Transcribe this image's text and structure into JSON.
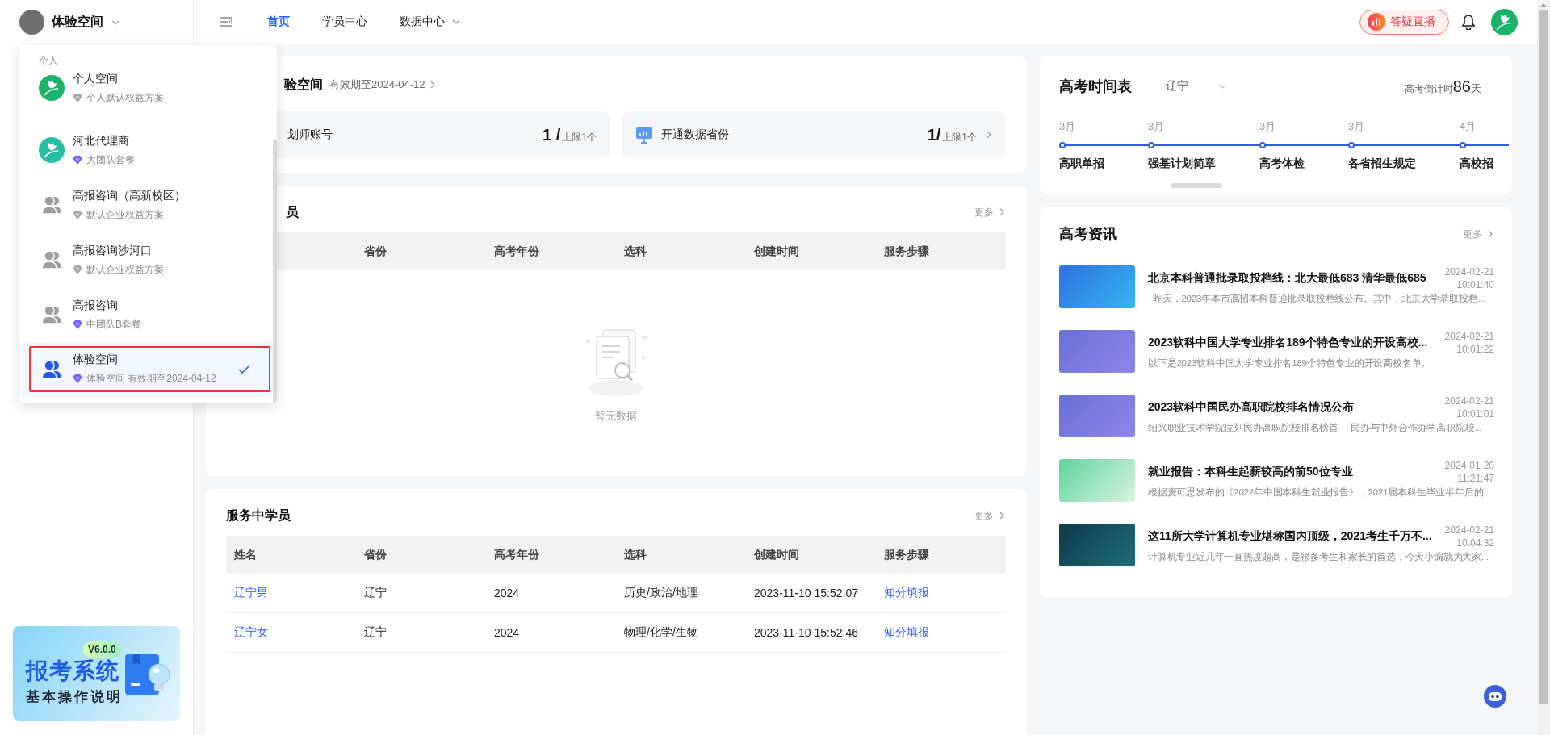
{
  "sidebar": {
    "account_name": "体验空间",
    "banner": {
      "version": "V6.0.0",
      "title": "报考系统",
      "subtitle": "基本操作说明"
    }
  },
  "topbar": {
    "nav": [
      {
        "label": "首页",
        "selected": true,
        "has_menu": false
      },
      {
        "label": "学员中心",
        "selected": false,
        "has_menu": false
      },
      {
        "label": "数据中心",
        "selected": false,
        "has_menu": true
      }
    ],
    "live_button": "答疑直播"
  },
  "space_summary": {
    "title": "验空间",
    "validity": "有效期至2024-04-12",
    "stats": [
      {
        "label": "划师账号",
        "count": "1 /",
        "limit": "上限1个",
        "has_icon": false,
        "has_arrow": false
      },
      {
        "label": "开通数据省份",
        "count": "1/",
        "limit": "上限1个",
        "has_icon": true,
        "has_arrow": true
      }
    ]
  },
  "pending_students": {
    "title": "员",
    "more": "更多",
    "columns": [
      "省份",
      "高考年份",
      "选科",
      "创建时间",
      "服务步骤"
    ],
    "empty_text": "暂无数据"
  },
  "serving_students": {
    "title": "服务中学员",
    "more": "更多",
    "columns": [
      "姓名",
      "省份",
      "高考年份",
      "选科",
      "创建时间",
      "服务步骤"
    ],
    "rows": [
      {
        "name": "辽宁男",
        "province": "辽宁",
        "year": "2024",
        "subjects": "历史/政治/地理",
        "created": "2023-11-10 15:52:07",
        "step": "知分填报"
      },
      {
        "name": "辽宁女",
        "province": "辽宁",
        "year": "2024",
        "subjects": "物理/化学/生物",
        "created": "2023-11-10 15:52:46",
        "step": "知分填报"
      }
    ]
  },
  "exam_schedule": {
    "title": "高考时间表",
    "province": "辽宁",
    "countdown_label": "高考倒计时",
    "countdown_days": "86",
    "countdown_unit": "天",
    "events": [
      {
        "month": "3月",
        "label": "高职单招"
      },
      {
        "month": "3月",
        "label": "强基计划简章"
      },
      {
        "month": "3月",
        "label": "高考体检"
      },
      {
        "month": "3月",
        "label": "各省招生规定"
      },
      {
        "month": "4月",
        "label": "高校招"
      }
    ]
  },
  "news": {
    "title": "高考资讯",
    "more": "更多",
    "items": [
      {
        "title": "北京本科普通批录取投档线：北大最低683 清华最低685",
        "date": "2024-02-21",
        "time": "10:01:40",
        "summary": "  昨天，2023年本市高招本科普通批录取投档线公布。其中，北京大学录取投档..."
      },
      {
        "title": "2023软科中国大学专业排名189个特色专业的开设高校...",
        "date": "2024-02-21",
        "time": "10:01:22",
        "summary": "以下是2023软科中国大学专业排名189个特色专业的开设高校名单。"
      },
      {
        "title": "2023软科中国民办高职院校排名情况公布",
        "date": "2024-02-21",
        "time": "10:01:01",
        "summary": "绍兴职业技术学院位列民办高职院校排名榜首     民办与中外合作办学高职院校..."
      },
      {
        "title": "就业报告：本科生起薪较高的前50位专业",
        "date": "2024-01-20",
        "time": "11:21:47",
        "summary": "根据麦可思发布的《2022年中国本科生就业报告》，2021届本科生毕业半年后的..."
      },
      {
        "title": "这11所大学计算机专业堪称国内顶级，2021考生千万不...",
        "date": "2024-02-21",
        "time": "10:04:32",
        "summary": "计算机专业近几年一直热度超高，是很多考生和家长的首选，今天小编就为大家..."
      }
    ]
  },
  "space_menu": {
    "groups": [
      {
        "label": "个人",
        "items": [
          {
            "name": "个人空间",
            "plan": "个人默认权益方案",
            "premium": false,
            "kind": "logo",
            "color": "#1bb36a",
            "selected": false
          }
        ]
      },
      {
        "items": [
          {
            "name": "河北代理商",
            "plan": "大团队套餐",
            "premium": true,
            "kind": "logo",
            "color": "#26bfa6",
            "selected": false
          },
          {
            "name": "高报咨询（高新校区）",
            "plan": "默认企业权益方案",
            "premium": false,
            "kind": "team",
            "color": "#9e9e9e",
            "selected": false
          },
          {
            "name": "高报咨询沙河口",
            "plan": "默认企业权益方案",
            "premium": false,
            "kind": "team",
            "color": "#9e9e9e",
            "selected": false
          },
          {
            "name": "高报咨询",
            "plan": "中团队B套餐",
            "premium": true,
            "kind": "team",
            "color": "#9e9e9e",
            "selected": false
          },
          {
            "name": "体验空间",
            "plan": "体验空间 有效期至2024-04-12",
            "premium": true,
            "kind": "team",
            "color": "#2557e8",
            "selected": true
          }
        ]
      }
    ]
  }
}
